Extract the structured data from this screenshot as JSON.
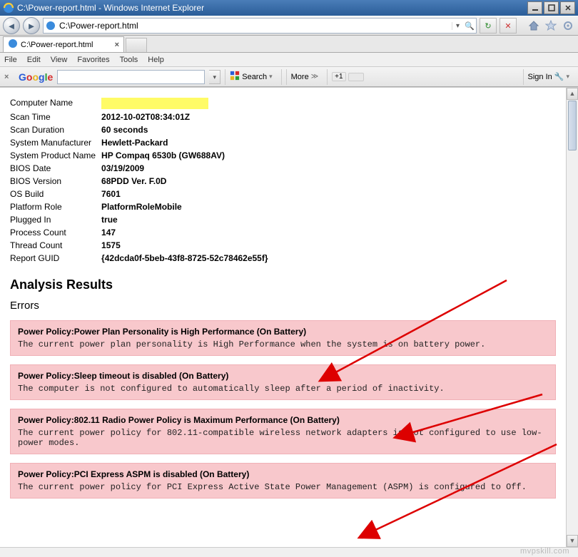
{
  "window": {
    "title": "C:\\Power-report.html - Windows Internet Explorer",
    "url": "C:\\Power-report.html",
    "tab_title": "C:\\Power-report.html"
  },
  "menubar": {
    "items": [
      "File",
      "Edit",
      "View",
      "Favorites",
      "Tools",
      "Help"
    ]
  },
  "googlebar": {
    "search_label": "Search",
    "more_label": "More",
    "plusone": "+1",
    "signin_label": "Sign In"
  },
  "report": {
    "rows": [
      {
        "label": "Computer Name",
        "value": ""
      },
      {
        "label": "Scan Time",
        "value": "2012-10-02T08:34:01Z"
      },
      {
        "label": "Scan Duration",
        "value": "60 seconds"
      },
      {
        "label": "System Manufacturer",
        "value": "Hewlett-Packard"
      },
      {
        "label": "System Product Name",
        "value": "HP Compaq 6530b (GW688AV)"
      },
      {
        "label": "BIOS Date",
        "value": "03/19/2009"
      },
      {
        "label": "BIOS Version",
        "value": "68PDD Ver. F.0D"
      },
      {
        "label": "OS Build",
        "value": "7601"
      },
      {
        "label": "Platform Role",
        "value": "PlatformRoleMobile"
      },
      {
        "label": "Plugged In",
        "value": "true"
      },
      {
        "label": "Process Count",
        "value": "147"
      },
      {
        "label": "Thread Count",
        "value": "1575"
      },
      {
        "label": "Report GUID",
        "value": "{42dcda0f-5beb-43f8-8725-52c78462e55f}"
      }
    ],
    "analysis_heading": "Analysis Results",
    "errors_heading": "Errors",
    "errors": [
      {
        "title": "Power Policy:Power Plan Personality is High Performance (On Battery)",
        "desc": "The current power plan personality is High Performance when the system is on battery power."
      },
      {
        "title": "Power Policy:Sleep timeout is disabled (On Battery)",
        "desc": "The computer is not configured to automatically sleep after a period of inactivity."
      },
      {
        "title": "Power Policy:802.11 Radio Power Policy is Maximum Performance (On Battery)",
        "desc": "The current power policy for 802.11-compatible wireless network adapters is not configured to use low-power modes."
      },
      {
        "title": "Power Policy:PCI Express ASPM is disabled (On Battery)",
        "desc": "The current power policy for PCI Express Active State Power Management (ASPM) is configured to Off."
      }
    ]
  },
  "watermark": "mvpskill.com"
}
